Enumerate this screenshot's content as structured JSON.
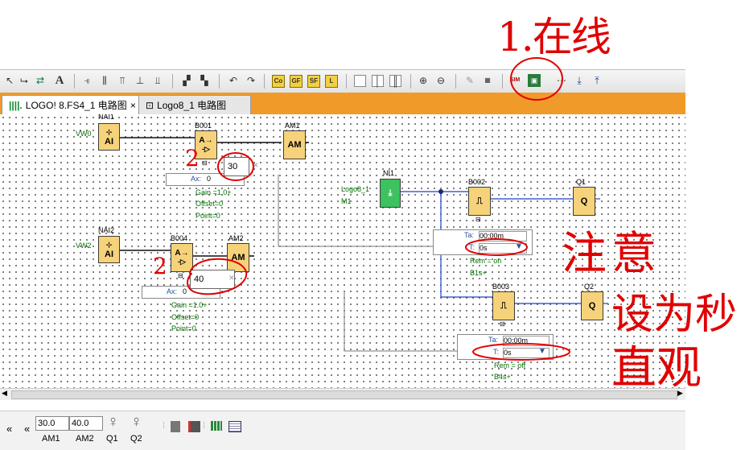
{
  "annotations": {
    "online": "1.在线",
    "two_a": "2",
    "two_b": "2",
    "note": "注意",
    "set_sec": "设为秒",
    "intuitive": "直观"
  },
  "tabs": [
    {
      "label": "LOGO! 8.FS4_1 电路图",
      "close": "×"
    },
    {
      "label": "Logo8_1 电路图"
    }
  ],
  "toolbar": {
    "text_tool": "A",
    "co": "Co",
    "gf": "GF",
    "sf": "SF",
    "l": "L",
    "sim": "SIM"
  },
  "diagram": {
    "nai1": "NAI1",
    "vw0": "VW0",
    "ai": "AI",
    "b001": "B001",
    "b001_sym": "A→",
    "am1": "AM1",
    "am": "AM",
    "param1": {
      "ax_label": "Ax:",
      "ax_value": "0",
      "value": "30",
      "gain": "Gain =1.0+",
      "offset": "Offset=0",
      "point": "Point=0"
    },
    "nai2": "NAI2",
    "vw2": "VW2",
    "b004": "B004",
    "b004_sym": "A→",
    "am2": "AM2",
    "param2": {
      "ax_label": "Ax:",
      "ax_value": "0",
      "value": "40",
      "gain": "Gain =1.0+",
      "offset": "Offset=0",
      "point": "Point=0"
    },
    "ni1": "NI1",
    "logo8": "Logo8_1",
    "m1": "M1",
    "b002": "B002",
    "q1": "Q1",
    "q": "Q",
    "b002_param": {
      "ta_label": "Ta:",
      "ta": "00:00m",
      "t_label": "T:",
      "t": "0s",
      "rem": "Rem = on",
      "b1s": "B1s+"
    },
    "b003": "B003",
    "q2": "Q2",
    "b003_param": {
      "ta_label": "Ta:",
      "ta": "00:00m",
      "t_label": "T:",
      "t": "0s",
      "rem": "Rem = off",
      "b4s": "B4s+"
    }
  },
  "status": {
    "arrows": "«",
    "am1_val": "30.0",
    "am2_val": "40.0",
    "am1": "AM1",
    "am2": "AM2",
    "q1": "Q1",
    "q2": "Q2"
  },
  "colors": {
    "tab_bar": "#f09a2a",
    "block": "#f6d27a",
    "annotation": "#e00000",
    "wire_blue": "#1f3fd0"
  }
}
